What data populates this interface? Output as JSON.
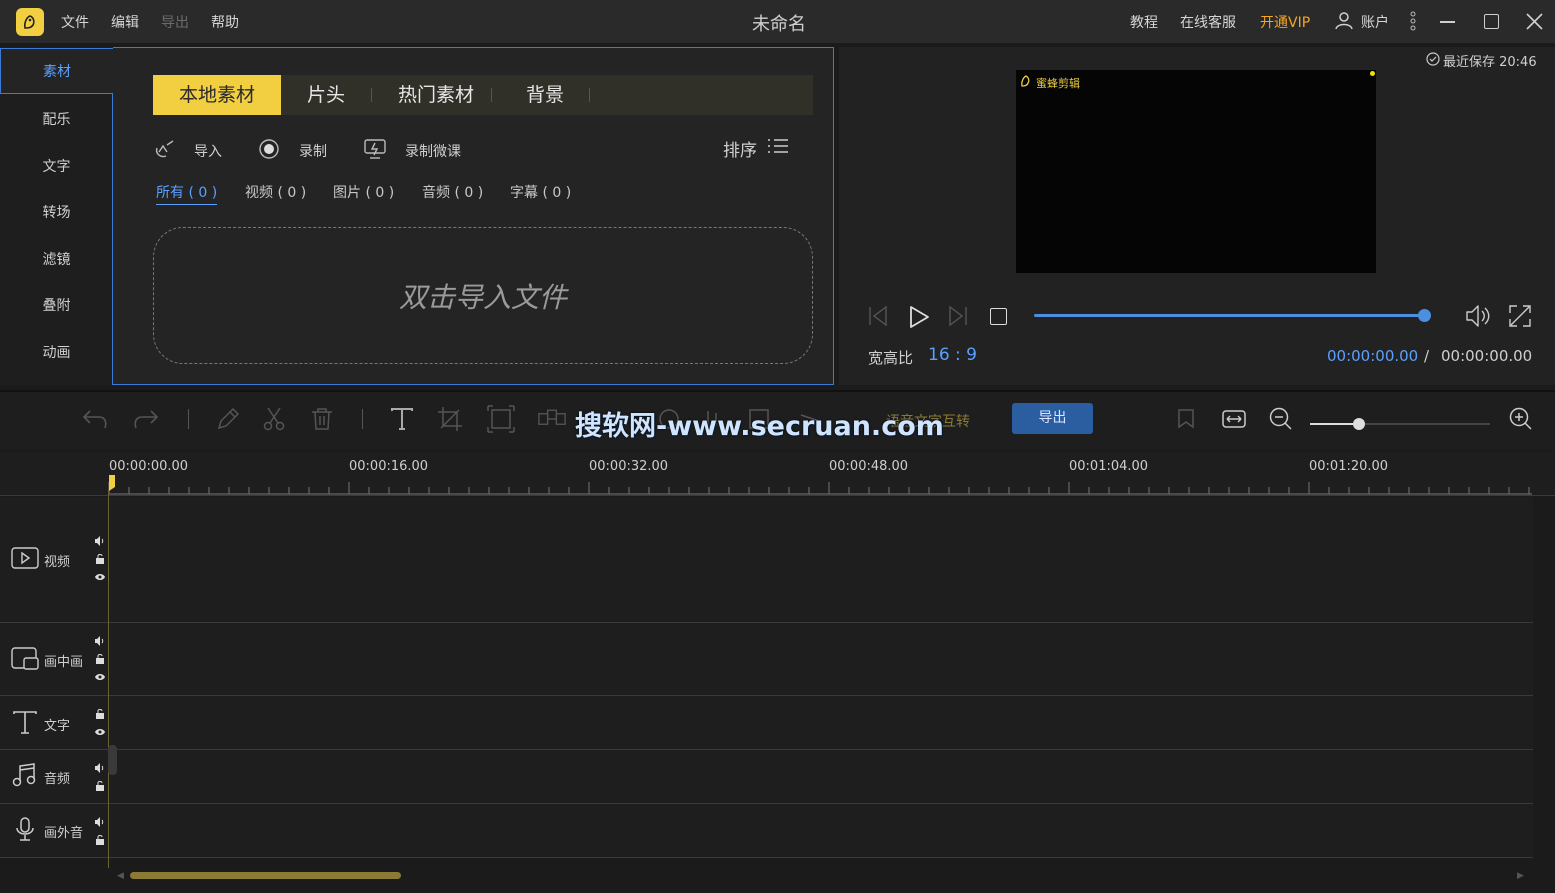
{
  "app": {
    "title": "未命名",
    "logo_icon": "bee-logo-icon",
    "accent": "#f2cf41",
    "vip_color": "#f5a623",
    "blue": "#4a8fe0"
  },
  "menu": [
    {
      "label": "文件",
      "enabled": true
    },
    {
      "label": "编辑",
      "enabled": true
    },
    {
      "label": "导出",
      "enabled": false
    },
    {
      "label": "帮助",
      "enabled": true
    }
  ],
  "titlebar_right": {
    "tutorial": "教程",
    "support": "在线客服",
    "vip": "开通VIP",
    "account": "账户"
  },
  "sidebar": {
    "items": [
      "素材",
      "配乐",
      "文字",
      "转场",
      "滤镜",
      "叠附",
      "动画"
    ],
    "active": 0
  },
  "material_tabs": {
    "items": [
      "本地素材",
      "片头",
      "热门素材",
      "背景"
    ],
    "active": 0
  },
  "actions": {
    "import": "导入",
    "record": "录制",
    "record_lecture": "录制微课",
    "sort": "排序"
  },
  "filters": {
    "items": [
      "所有 ( 0 )",
      "视频 ( 0 )",
      "图片 ( 0 )",
      "音频 ( 0 )",
      "字幕 ( 0 )"
    ],
    "active": 0
  },
  "dropzone": {
    "text": "双击导入文件"
  },
  "preview": {
    "last_saved": "最近保存 20:46",
    "screen_watermark": "蜜蜂剪辑",
    "aspect_label": "宽高比",
    "aspect_value": "16 : 9",
    "current_time": "00:00:00.00",
    "separator": "/",
    "total_time": "00:00:00.00",
    "progress": 1.0
  },
  "toolbar": {
    "export_label": "导出",
    "voice_to_text": "语音文字互转"
  },
  "watermark_overlay": "搜软网-www.secruan.com",
  "timeline": {
    "ruler": [
      "00:00:00.00",
      "00:00:16.00",
      "00:00:32.00",
      "00:00:48.00",
      "00:01:04.00",
      "00:01:20.00"
    ],
    "tracks": [
      {
        "label": "视频",
        "icon": "video-track-icon"
      },
      {
        "label": "画中画",
        "icon": "pip-track-icon"
      },
      {
        "label": "文字",
        "icon": "text-track-icon"
      },
      {
        "label": "音频",
        "icon": "music-track-icon"
      },
      {
        "label": "画外音",
        "icon": "microphone-track-icon"
      }
    ]
  }
}
